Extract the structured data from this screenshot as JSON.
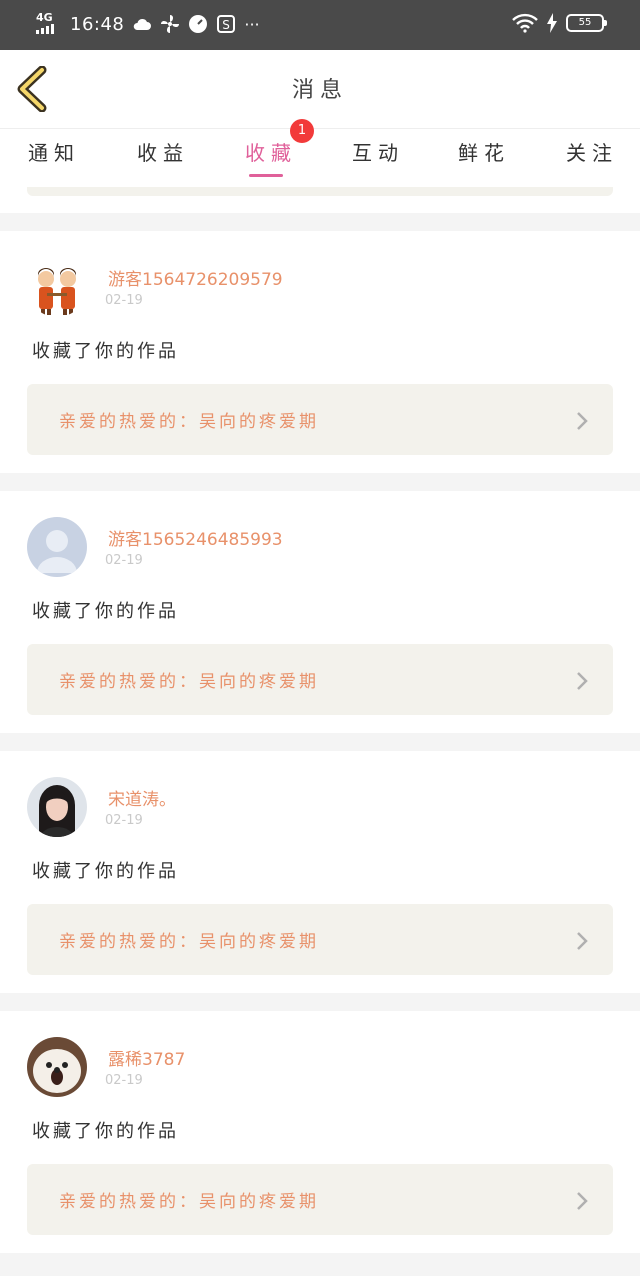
{
  "status": {
    "network": "4G",
    "time": "16:48",
    "more": "···",
    "battery": "55"
  },
  "header": {
    "title": "消息"
  },
  "tabs": [
    {
      "label": "通知"
    },
    {
      "label": "收益"
    },
    {
      "label": "收藏",
      "active": true,
      "badge": "1"
    },
    {
      "label": "互动"
    },
    {
      "label": "鲜花"
    },
    {
      "label": "关注"
    }
  ],
  "items": [
    {
      "user": "游客1564726209579",
      "date": "02-19",
      "action": "收藏了你的作品",
      "work": "亲爱的热爱的：吴向的疼爱期",
      "avatar": "cartoon-couple"
    },
    {
      "user": "游客1565246485993",
      "date": "02-19",
      "action": "收藏了你的作品",
      "work": "亲爱的热爱的：吴向的疼爱期",
      "avatar": "default-person"
    },
    {
      "user": "宋道涛。",
      "date": "02-19",
      "action": "收藏了你的作品",
      "work": "亲爱的热爱的：吴向的疼爱期",
      "avatar": "woman-photo"
    },
    {
      "user": "露稀3787",
      "date": "02-19",
      "action": "收藏了你的作品",
      "work": "亲爱的热爱的：吴向的疼爱期",
      "avatar": "dog-photo"
    }
  ],
  "colors": {
    "accent": "#e0609a",
    "name": "#e8916a",
    "badge": "#f23a3a",
    "work_bg": "#f3f2ec"
  }
}
